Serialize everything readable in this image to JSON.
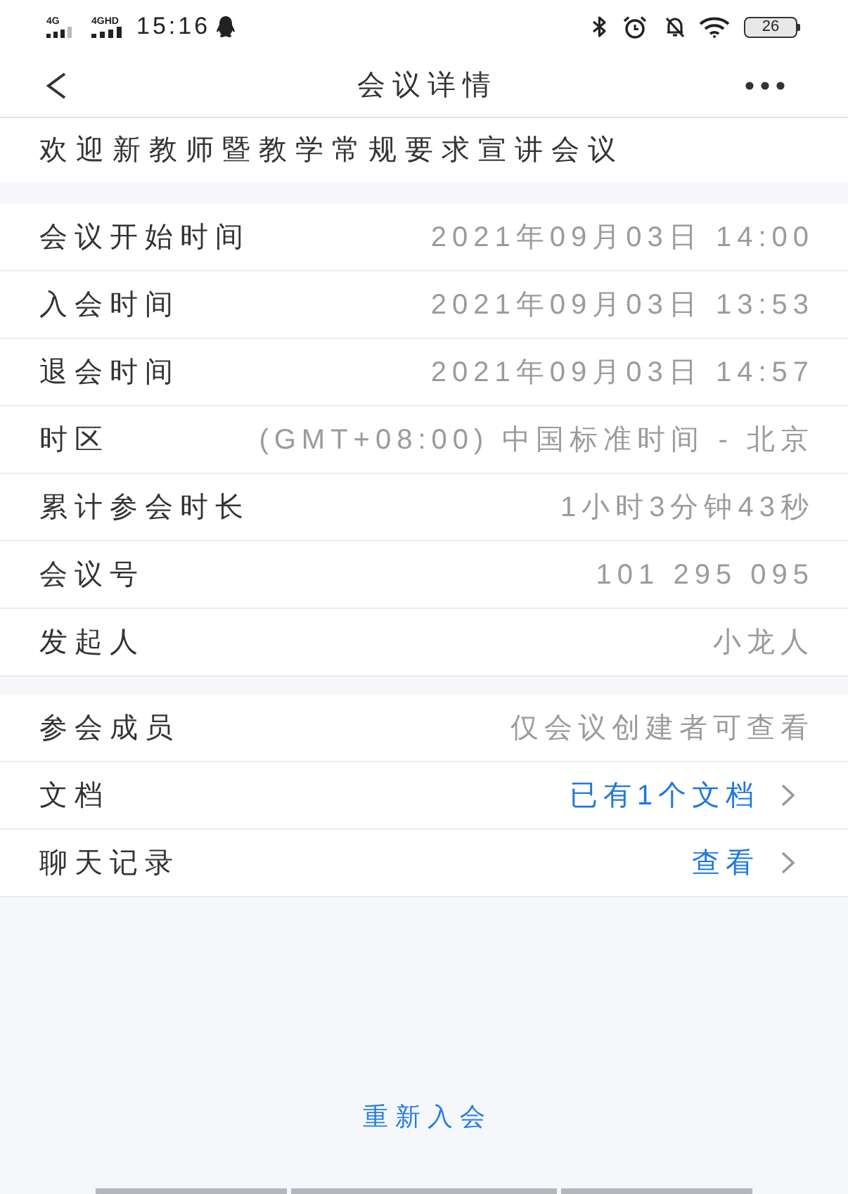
{
  "status_bar": {
    "network_1": "4G",
    "network_2": "4GHD",
    "time": "15:16",
    "battery": "26"
  },
  "header": {
    "title": "会议详情"
  },
  "meeting_title": "欢迎新教师暨教学常规要求宣讲会议",
  "sections": [
    {
      "rows": [
        {
          "kind": "info",
          "label": "会议开始时间",
          "value": "2021年09月03日 14:00"
        },
        {
          "kind": "info",
          "label": "入会时间",
          "value": "2021年09月03日 13:53"
        },
        {
          "kind": "info",
          "label": "退会时间",
          "value": "2021年09月03日 14:57"
        },
        {
          "kind": "info",
          "label": "时区",
          "value": "(GMT+08:00) 中国标准时间 - 北京"
        },
        {
          "kind": "info",
          "label": "累计参会时长",
          "value": "1小时3分钟43秒"
        },
        {
          "kind": "info",
          "label": "会议号",
          "value": "101 295 095"
        },
        {
          "kind": "info",
          "label": "发起人",
          "value": "小龙人"
        }
      ]
    },
    {
      "rows": [
        {
          "kind": "info",
          "label": "参会成员",
          "value": "仅会议创建者可查看"
        },
        {
          "kind": "link",
          "label": "文档",
          "value": "已有1个文档"
        },
        {
          "kind": "link",
          "label": "聊天记录",
          "value": "查看"
        }
      ]
    }
  ],
  "rejoin_button": {
    "label": "重新入会"
  }
}
